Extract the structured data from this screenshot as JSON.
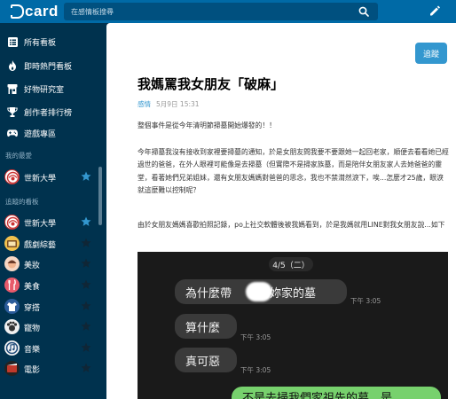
{
  "brand": {
    "logo_text": "card"
  },
  "search": {
    "placeholder": "在感情板搜尋"
  },
  "sidebar": {
    "nav": [
      {
        "label": "所有看板",
        "icon": "list-icon"
      },
      {
        "label": "即時熱門看板",
        "icon": "fire-icon"
      },
      {
        "label": "好物研究室",
        "icon": "store-icon"
      },
      {
        "label": "創作者排行榜",
        "icon": "trophy-icon"
      },
      {
        "label": "遊戲專區",
        "icon": "gamepad-icon"
      }
    ],
    "favorites_heading": "我的最愛",
    "favorites": [
      {
        "label": "世新大學",
        "starred": true
      }
    ],
    "following_heading": "追蹤的看板",
    "following": [
      {
        "label": "世新大學",
        "starred": true
      },
      {
        "label": "戲劇綜藝",
        "starred": false
      },
      {
        "label": "美妝",
        "starred": false
      },
      {
        "label": "美食",
        "starred": false
      },
      {
        "label": "穿搭",
        "starred": false
      },
      {
        "label": "寵物",
        "starred": false
      },
      {
        "label": "音樂",
        "starred": false
      },
      {
        "label": "電影",
        "starred": false
      }
    ]
  },
  "post": {
    "follow_label": "追蹤",
    "title": "我媽罵我女朋友「破麻」",
    "board": "感情",
    "date": "5月9日 15:31",
    "paragraphs": [
      "整個事件是從今年清明節掃墓開始爆發的！！",
      "今年掃墓我沒有接收到家裡要掃墓的通知，於是女朋友問我要不要跟她一起回老家，順便去看看她已經過世的爸爸，在外人眼裡可能像是去掃墓（但實際不是掃家族墓，而是陪伴女朋友家人去她爸爸的靈堂，看著她們兄弟姐妹，還有女朋友媽媽對爸爸的思念，我也不禁潸然淚下，唉...怎麼才25歲，眼淚就這麼難以控制呢？",
      "由於女朋友媽媽喜歡拍照記錄，po上社交軟體後被我媽看到，於是我媽就用LINE對我女朋友說...如下"
    ],
    "chat": {
      "date": "4/5（二）",
      "messages": [
        {
          "text": "為什麼帶",
          "tail": "掃妳家的墓",
          "time": "下午 3:05"
        },
        {
          "text": "算什麼",
          "time": "下午 3:05"
        },
        {
          "text": "真可惡",
          "time": "下午 3:05"
        }
      ],
      "reply": "不是去掃我們家祖先的墓，是"
    }
  },
  "colors": {
    "topbar": "#006aa6",
    "sidebar": "#00324e",
    "accent": "#3397cf",
    "star_on": "#3397cf",
    "chat_me": "#77d16d"
  }
}
